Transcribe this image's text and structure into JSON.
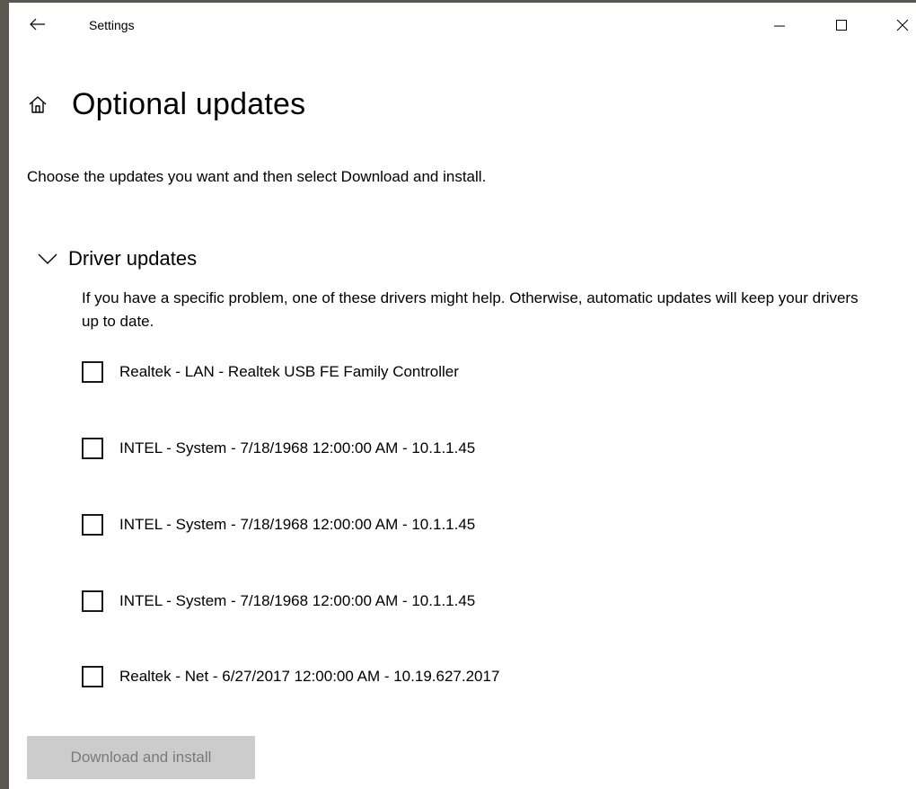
{
  "window": {
    "title": "Settings",
    "controls": {
      "back": "back-arrow-icon",
      "minimize": "minimize-icon",
      "maximize": "maximize-icon",
      "close": "close-icon"
    }
  },
  "page": {
    "title": "Optional updates",
    "home_icon": "home-icon",
    "intro": "Choose the updates you want and then select Download and install."
  },
  "driver_section": {
    "title": "Driver updates",
    "expanded": true,
    "description": "If you have a specific problem, one of these drivers might help. Otherwise, automatic updates will keep your drivers up to date.",
    "items": [
      {
        "label": "Realtek - LAN - Realtek USB FE Family Controller",
        "checked": false
      },
      {
        "label": "INTEL - System - 7/18/1968 12:00:00 AM - 10.1.1.45",
        "checked": false
      },
      {
        "label": "INTEL - System - 7/18/1968 12:00:00 AM - 10.1.1.45",
        "checked": false
      },
      {
        "label": "INTEL - System - 7/18/1968 12:00:00 AM - 10.1.1.45",
        "checked": false
      },
      {
        "label": "Realtek - Net - 6/27/2017 12:00:00 AM - 10.19.627.2017",
        "checked": false
      }
    ]
  },
  "actions": {
    "download_label": "Download and install",
    "download_enabled": false
  },
  "colors": {
    "background": "#ffffff",
    "disabled_button_bg": "#cccccc",
    "disabled_button_text": "#7a7a7a",
    "text": "#000000"
  }
}
